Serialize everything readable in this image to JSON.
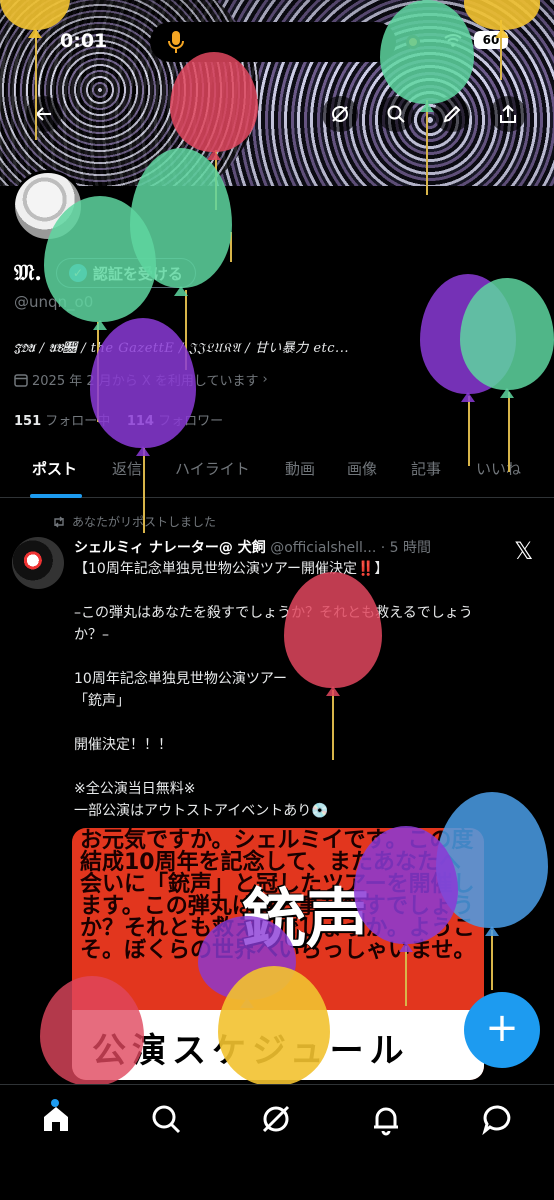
{
  "status_bar": {
    "time": "0:01",
    "battery": "60"
  },
  "profile": {
    "name": "𝔐.",
    "verify_label": "認証を受ける",
    "handle": "@unqn_o0",
    "bio": "𝔍𝔇𝔄 / 𝔄𝔅𝔆 / the GazettE / 𝔍𝔍𝔏𝔘𝔎𝔄 / 甘い暴力 etc...",
    "joined": "2025 年 2 月から X を利用しています",
    "following_count": "151",
    "following_label": "フォロー中",
    "followers_count": "114",
    "followers_label": "フォロワー"
  },
  "tabs": [
    {
      "label": "ポスト",
      "active": true
    },
    {
      "label": "返信"
    },
    {
      "label": "ハイライト"
    },
    {
      "label": "動画"
    },
    {
      "label": "画像"
    },
    {
      "label": "記事"
    },
    {
      "label": "いいね"
    }
  ],
  "post": {
    "repost_label": "あなたがリポストしました",
    "author_name": "シェルミィ ナレーター@ 犬飼",
    "author_handle": "@officialshell...",
    "time": "5 時間",
    "line1": "【10周年記念単独見世物公演ツアー開催決定‼️】",
    "line2": "–この弾丸はあなたを殺すでしょうか？それとも救えるでしょうか？–",
    "line3": "10周年記念単独見世物公演ツアー",
    "line4": "「銃声」",
    "line5": "開催決定！！！",
    "line6": "※全公演当日無料※",
    "line7": "一部公演はアウトストアイベントあり💿",
    "poster_text": "お元気ですか。シェルミイです。この度結成10周年を記念して、またあなたへ会いに「銃声」と冠したツアーを開催します。この弾丸は貴方事を殺すでしょうか？それとも救えるでしょうか。ようこそ。ぼくらの世界へいらっしゃいませ。",
    "poster_title": "銃声",
    "poster_bottom": "公演スケジュール"
  },
  "colors": {
    "accent": "#1d9bf0",
    "balloon_green": "#5ed6a0",
    "balloon_red": "#e0475e",
    "balloon_purple": "#8a3ad6",
    "balloon_yellow": "#f2c230",
    "balloon_blue": "#4a9ee8"
  },
  "icons": [
    "back-arrow-icon",
    "grok-icon",
    "search-icon",
    "edit-icon",
    "share-icon",
    "calendar-icon",
    "chevron-right-icon",
    "repost-icon",
    "x-logo-icon",
    "plus-icon",
    "home-icon",
    "explore-icon",
    "grok-nav-icon",
    "bell-icon",
    "messages-icon"
  ]
}
